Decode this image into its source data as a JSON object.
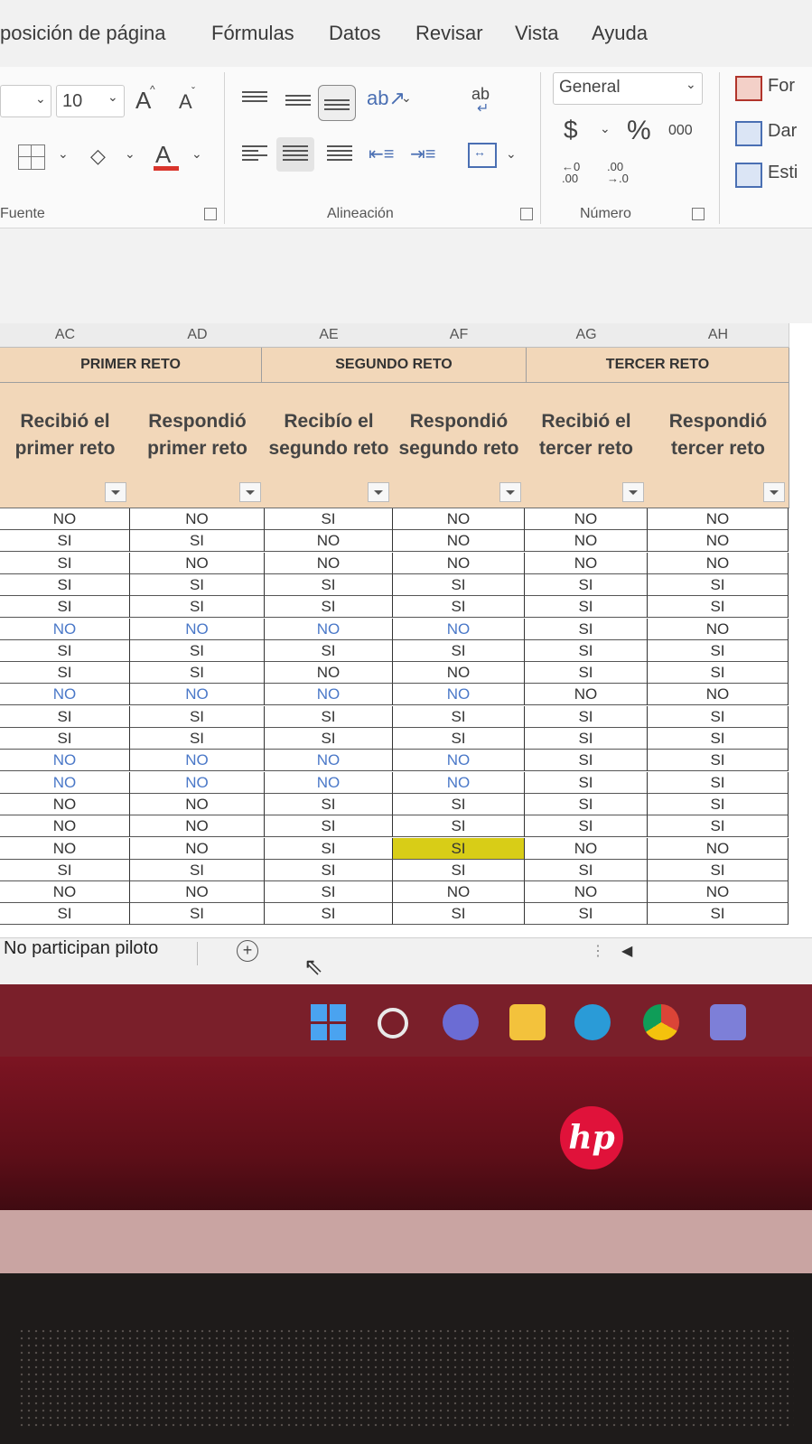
{
  "menu": {
    "tabs": [
      "posición de página",
      "Fórmulas",
      "Datos",
      "Revisar",
      "Vista",
      "Ayuda"
    ]
  },
  "ribbon": {
    "font_size": "10",
    "grow_font": "A",
    "shrink_font": "A",
    "font_color_letter": "A",
    "wrap_text_label": "ab",
    "number_format": "General",
    "currency_symbol": "$",
    "percent_symbol": "%",
    "thousands_label": "000",
    "increase_decimals": "←0\n.00",
    "decrease_decimals": ".00\n→.0",
    "right_buttons": [
      "For",
      "Dar",
      "Esti"
    ],
    "groups": {
      "font": "Fuente",
      "alignment": "Alineación",
      "number": "Número"
    }
  },
  "sheet": {
    "columns": [
      "AC",
      "AD",
      "AE",
      "AF",
      "AG",
      "AH"
    ],
    "groups": [
      "PRIMER RETO",
      "SEGUNDO RETO",
      "TERCER RETO"
    ],
    "headers": [
      "Recibió el primer reto",
      "Respondió primer reto",
      "Recibío el segundo reto",
      "Respondió segundo reto",
      "Recibió el tercer reto",
      "Respondió tercer reto"
    ],
    "rows": [
      [
        "NO",
        "NO",
        "SI",
        "NO",
        "NO",
        "NO"
      ],
      [
        "SI",
        "SI",
        "NO",
        "NO",
        "NO",
        "NO"
      ],
      [
        "SI",
        "NO",
        "NO",
        "NO",
        "NO",
        "NO"
      ],
      [
        "SI",
        "SI",
        "SI",
        "SI",
        "SI",
        "SI"
      ],
      [
        "SI",
        "SI",
        "SI",
        "SI",
        "SI",
        "SI"
      ],
      [
        "NO",
        "NO",
        "NO",
        "NO",
        "SI",
        "NO"
      ],
      [
        "SI",
        "SI",
        "SI",
        "SI",
        "SI",
        "SI"
      ],
      [
        "SI",
        "SI",
        "NO",
        "NO",
        "SI",
        "SI"
      ],
      [
        "NO",
        "NO",
        "NO",
        "NO",
        "NO",
        "NO"
      ],
      [
        "SI",
        "SI",
        "SI",
        "SI",
        "SI",
        "SI"
      ],
      [
        "SI",
        "SI",
        "SI",
        "SI",
        "SI",
        "SI"
      ],
      [
        "NO",
        "NO",
        "NO",
        "NO",
        "SI",
        "SI"
      ],
      [
        "NO",
        "NO",
        "NO",
        "NO",
        "SI",
        "SI"
      ],
      [
        "NO",
        "NO",
        "SI",
        "SI",
        "SI",
        "SI"
      ],
      [
        "NO",
        "NO",
        "SI",
        "SI",
        "SI",
        "SI"
      ],
      [
        "NO",
        "NO",
        "SI",
        "SI",
        "NO",
        "NO"
      ],
      [
        "SI",
        "SI",
        "SI",
        "SI",
        "SI",
        "SI"
      ],
      [
        "NO",
        "NO",
        "SI",
        "NO",
        "NO",
        "NO"
      ],
      [
        "SI",
        "SI",
        "SI",
        "SI",
        "SI",
        "SI"
      ]
    ],
    "blue_rows": [
      5,
      8,
      11,
      12
    ],
    "highlight_cell": {
      "row": 15,
      "col": 3
    },
    "highlight_color": "#d8cd17"
  },
  "sheet_tabs": {
    "active": "No participan piloto",
    "add_symbol": "+"
  },
  "taskbar": {
    "icons": [
      "windows-start-icon",
      "search-icon",
      "teams-chat-icon",
      "file-explorer-icon",
      "edge-icon",
      "chrome-icon",
      "mail-icon"
    ]
  },
  "brand": {
    "logo_text": "hp"
  }
}
